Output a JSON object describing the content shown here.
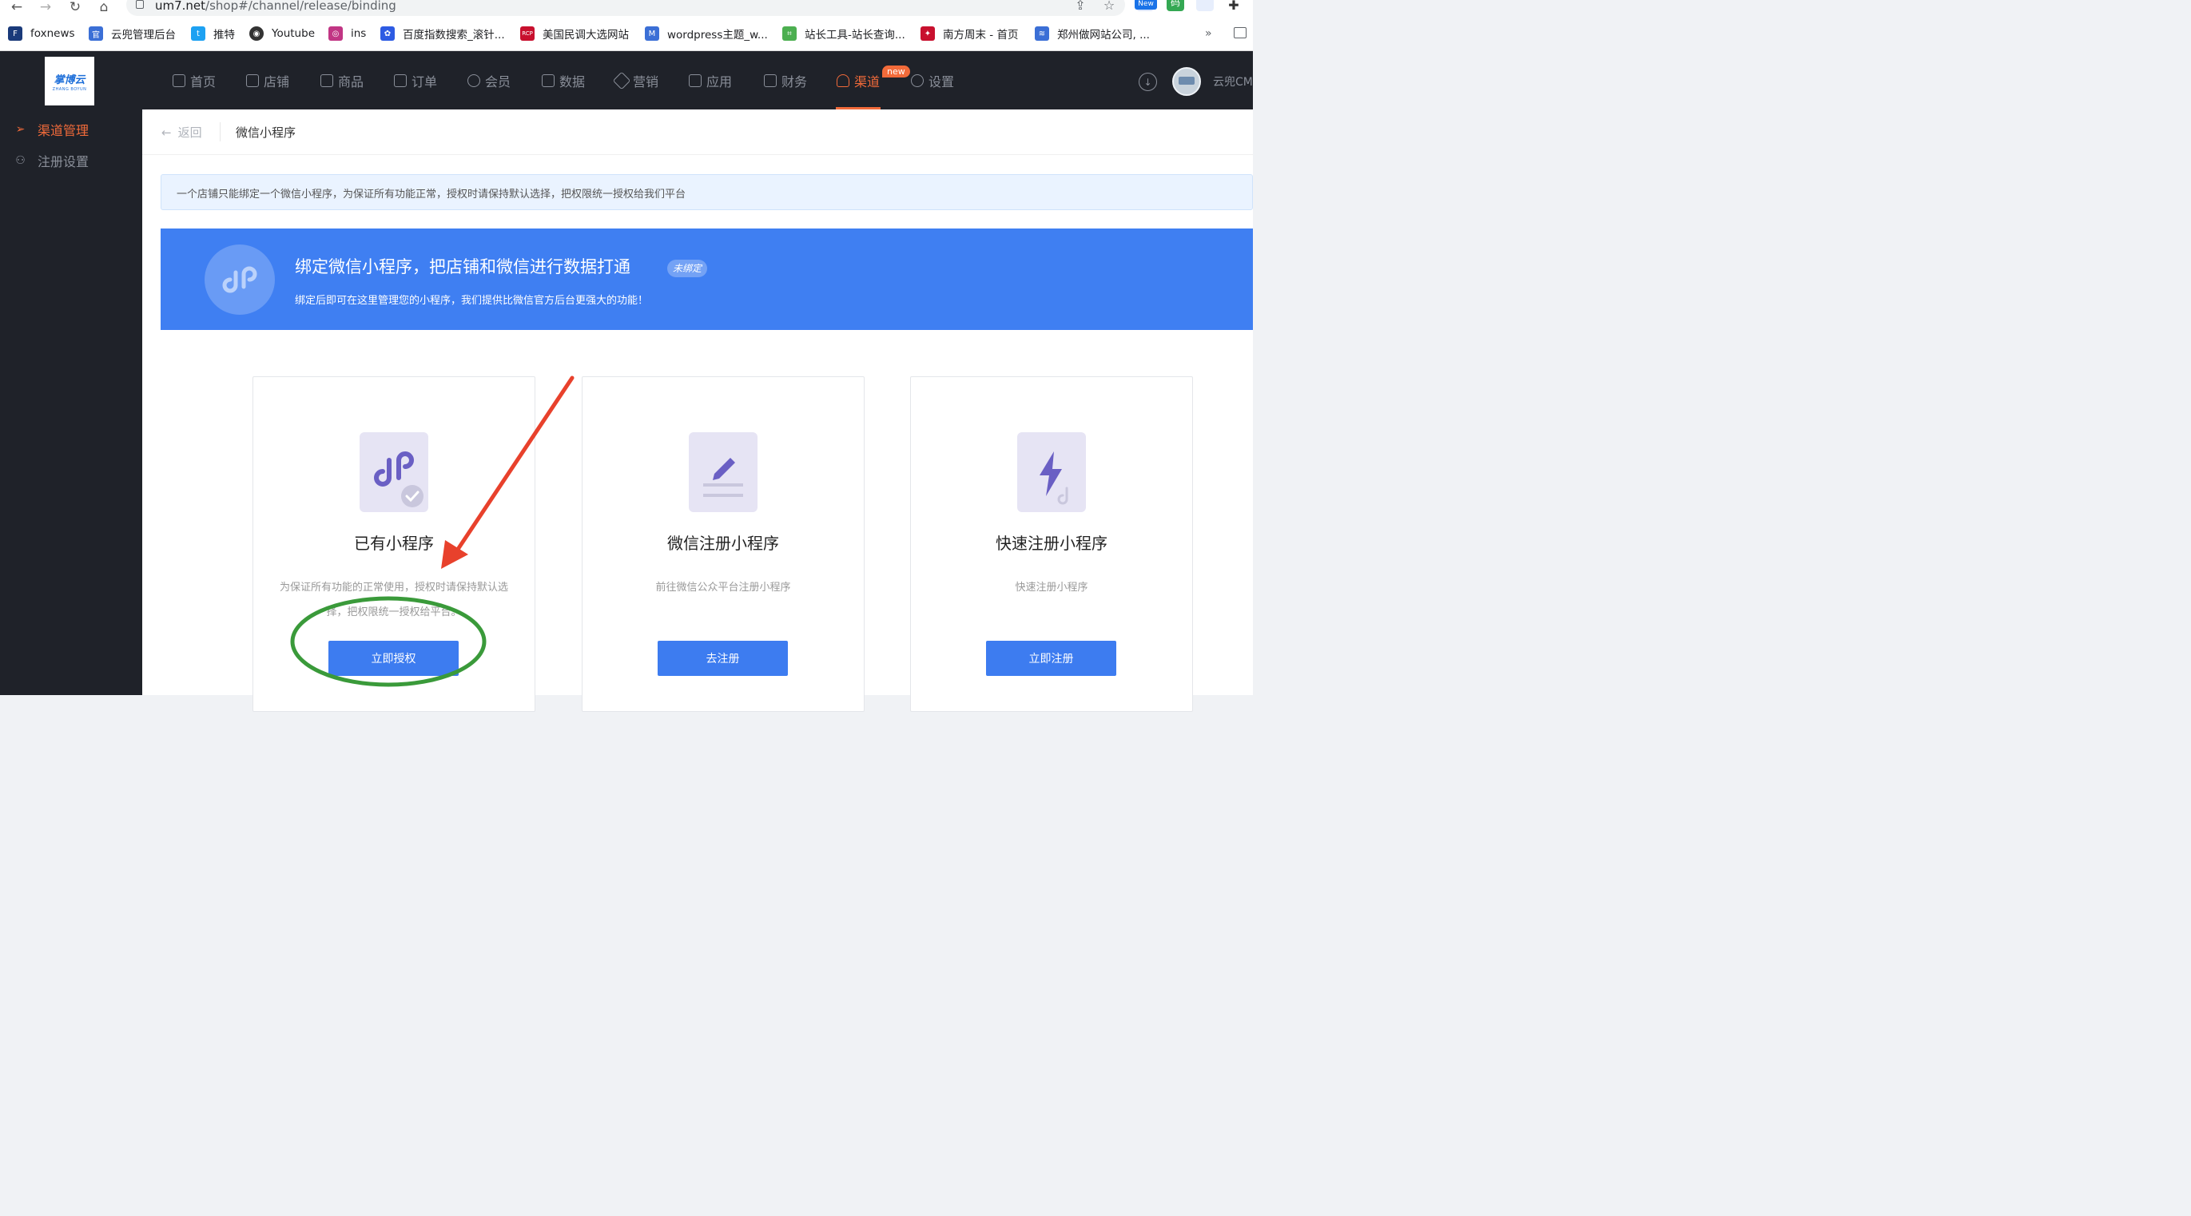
{
  "browser": {
    "url_host": "um7.net",
    "url_path": "/shop#/channel/release/binding",
    "ext_badge": "New",
    "ext2_label": "码",
    "bookmarks": [
      {
        "label": "foxnews",
        "color": "#1a3a7a",
        "glyph": "F"
      },
      {
        "label": "云兜管理后台",
        "color": "#3b6fd6",
        "glyph": "官"
      },
      {
        "label": "推特",
        "color": "#1da1f2",
        "glyph": "t"
      },
      {
        "label": "Youtube",
        "color": "#333333",
        "glyph": "◉"
      },
      {
        "label": "ins",
        "color": "#c13584",
        "glyph": "◎"
      },
      {
        "label": "百度指数搜索_滚针...",
        "color": "#2d5be3",
        "glyph": "✿"
      },
      {
        "label": "美国民调大选网站",
        "color": "#c8102e",
        "glyph": "RCP"
      },
      {
        "label": "wordpress主题_w...",
        "color": "#3b6fd6",
        "glyph": "M"
      },
      {
        "label": "站长工具-站长查询...",
        "color": "#4caf50",
        "glyph": "⌗"
      },
      {
        "label": "南方周末 - 首页",
        "color": "#c8102e",
        "glyph": "✦"
      },
      {
        "label": "郑州做网站公司, ...",
        "color": "#3b6fd6",
        "glyph": "≋"
      }
    ],
    "more": "»"
  },
  "app": {
    "logo_text": "掌博云",
    "logo_sub": "ZHANG BOYUN",
    "nav": [
      {
        "label": "首页",
        "active": false
      },
      {
        "label": "店铺",
        "active": false
      },
      {
        "label": "商品",
        "active": false
      },
      {
        "label": "订单",
        "active": false
      },
      {
        "label": "会员",
        "active": false
      },
      {
        "label": "数据",
        "active": false
      },
      {
        "label": "营销",
        "active": false
      },
      {
        "label": "应用",
        "active": false
      },
      {
        "label": "财务",
        "active": false
      },
      {
        "label": "渠道",
        "active": true
      },
      {
        "label": "设置",
        "active": false
      }
    ],
    "new_badge": "new",
    "user_name": "云兜CM"
  },
  "sidebar": {
    "items": [
      {
        "label": "渠道管理",
        "active": true
      },
      {
        "label": "注册设置",
        "active": false
      }
    ]
  },
  "page": {
    "back_label": "返回",
    "title": "微信小程序",
    "tip": "一个店铺只能绑定一个微信小程序，为保证所有功能正常，授权时请保持默认选择，把权限统一授权给我们平台",
    "hero_title": "绑定微信小程序，把店铺和微信进行数据打通",
    "hero_badge": "未绑定",
    "hero_sub": "绑定后即可在这里管理您的小程序，我们提供比微信官方后台更强大的功能！"
  },
  "cards": [
    {
      "title": "已有小程序",
      "desc": "为保证所有功能的正常使用，授权时请保持默认选择，把权限统一授权给平台。",
      "button": "立即授权"
    },
    {
      "title": "微信注册小程序",
      "desc": "前往微信公众平台注册小程序",
      "button": "去注册"
    },
    {
      "title": "快速注册小程序",
      "desc": "快速注册小程序",
      "button": "立即注册"
    }
  ],
  "colors": {
    "accent": "#f26b3a",
    "primary": "#3d7cf0",
    "hero_bg": "#3f7ff2",
    "nav_bg": "#1f2229",
    "annotation_arrow": "#e8412c",
    "annotation_ellipse": "#3a9a3a"
  }
}
